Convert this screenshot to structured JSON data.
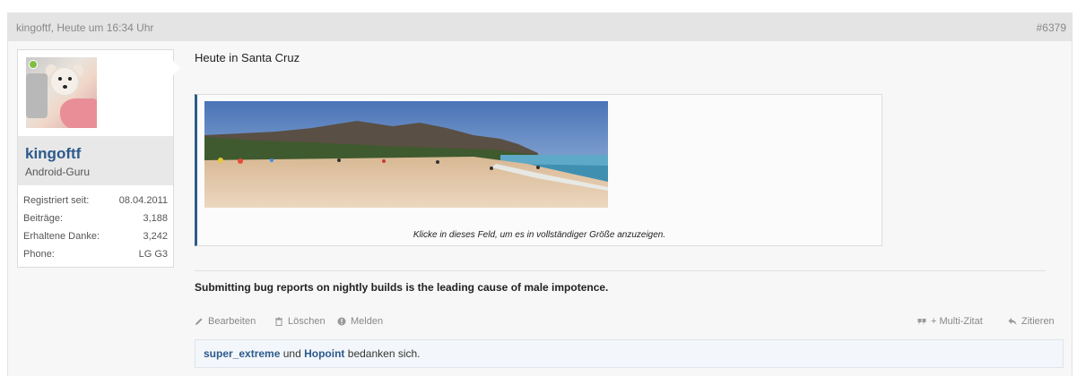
{
  "post": {
    "author_time": "kingoftf, Heute um 16:34 Uhr",
    "number": "#6379",
    "title_line": "Heute in Santa Cruz",
    "attachment_caption": "Klicke in dieses Feld, um es in vollständiger Größe anzuzeigen.",
    "signature": "Submitting bug reports on nightly builds is the leading cause of male impotence."
  },
  "user": {
    "name": "kingoftf",
    "title": "Android-Guru",
    "stats": [
      {
        "label": "Registriert seit:",
        "value": "08.04.2011"
      },
      {
        "label": "Beiträge:",
        "value": "3,188"
      },
      {
        "label": "Erhaltene Danke:",
        "value": "3,242"
      },
      {
        "label": "Phone:",
        "value": "LG G3"
      }
    ]
  },
  "actions": {
    "edit": "Bearbeiten",
    "delete": "Löschen",
    "report": "Melden",
    "multiquote": "+ Multi-Zitat",
    "quote": "Zitieren"
  },
  "likes": {
    "user1": "super_extreme",
    "connector": "und",
    "user2": "Hopoint",
    "suffix": "bedanken sich."
  },
  "icons": {
    "edit": "pencil-icon",
    "delete": "trash-icon",
    "report": "exclamation-icon",
    "multiquote": "quote-icon",
    "quote": "reply-arrow-icon"
  },
  "colors": {
    "link": "#2c5a8c",
    "attachment_bar": "#2d5c88",
    "online": "#7fbf3f"
  }
}
